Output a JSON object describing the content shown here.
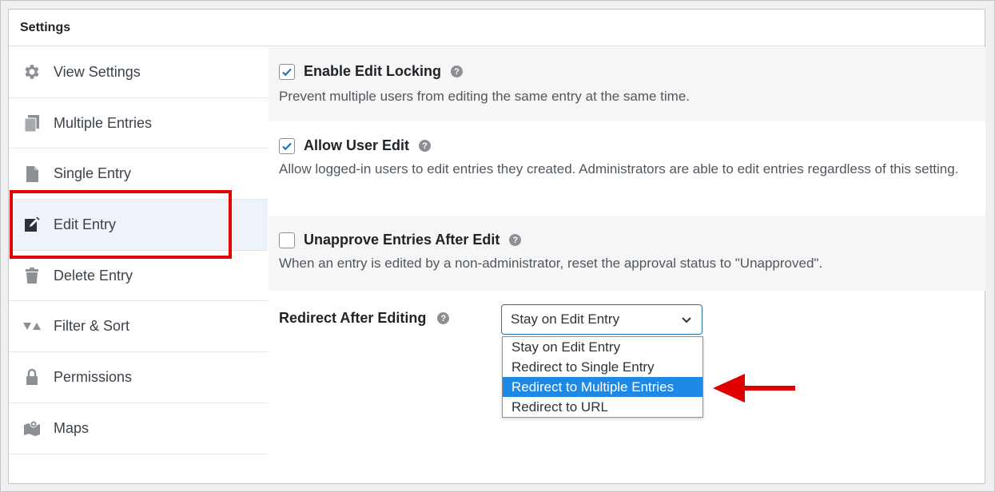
{
  "panel": {
    "title": "Settings"
  },
  "sidebar": {
    "items": [
      {
        "label": "View Settings",
        "icon": "gear-icon"
      },
      {
        "label": "Multiple Entries",
        "icon": "copy-icon"
      },
      {
        "label": "Single Entry",
        "icon": "page-icon"
      },
      {
        "label": "Edit Entry",
        "icon": "edit-icon",
        "active": true
      },
      {
        "label": "Delete Entry",
        "icon": "trash-icon"
      },
      {
        "label": "Filter & Sort",
        "icon": "filter-icon"
      },
      {
        "label": "Permissions",
        "icon": "lock-icon"
      },
      {
        "label": "Maps",
        "icon": "map-icon"
      }
    ]
  },
  "settings": {
    "edit_locking": {
      "label": "Enable Edit Locking",
      "checked": true,
      "description": "Prevent multiple users from editing the same entry at the same time."
    },
    "user_edit": {
      "label": "Allow User Edit",
      "checked": true,
      "description": "Allow logged-in users to edit entries they created. Administrators are able to edit entries regardless of this setting."
    },
    "unapprove": {
      "label": "Unapprove Entries After Edit",
      "checked": false,
      "description": "When an entry is edited by a non-administrator, reset the approval status to \"Unapproved\"."
    },
    "redirect": {
      "label": "Redirect After Editing",
      "selected_value": "Stay on Edit Entry",
      "options": [
        "Stay on Edit Entry",
        "Redirect to Single Entry",
        "Redirect to Multiple Entries",
        "Redirect to URL"
      ],
      "highlighted_option": "Redirect to Multiple Entries"
    }
  },
  "colors": {
    "accent": "#2271b1",
    "highlight_option": "#1e88e5",
    "annotation_red": "#e10000",
    "active_sidebar": "#eef2f9"
  }
}
